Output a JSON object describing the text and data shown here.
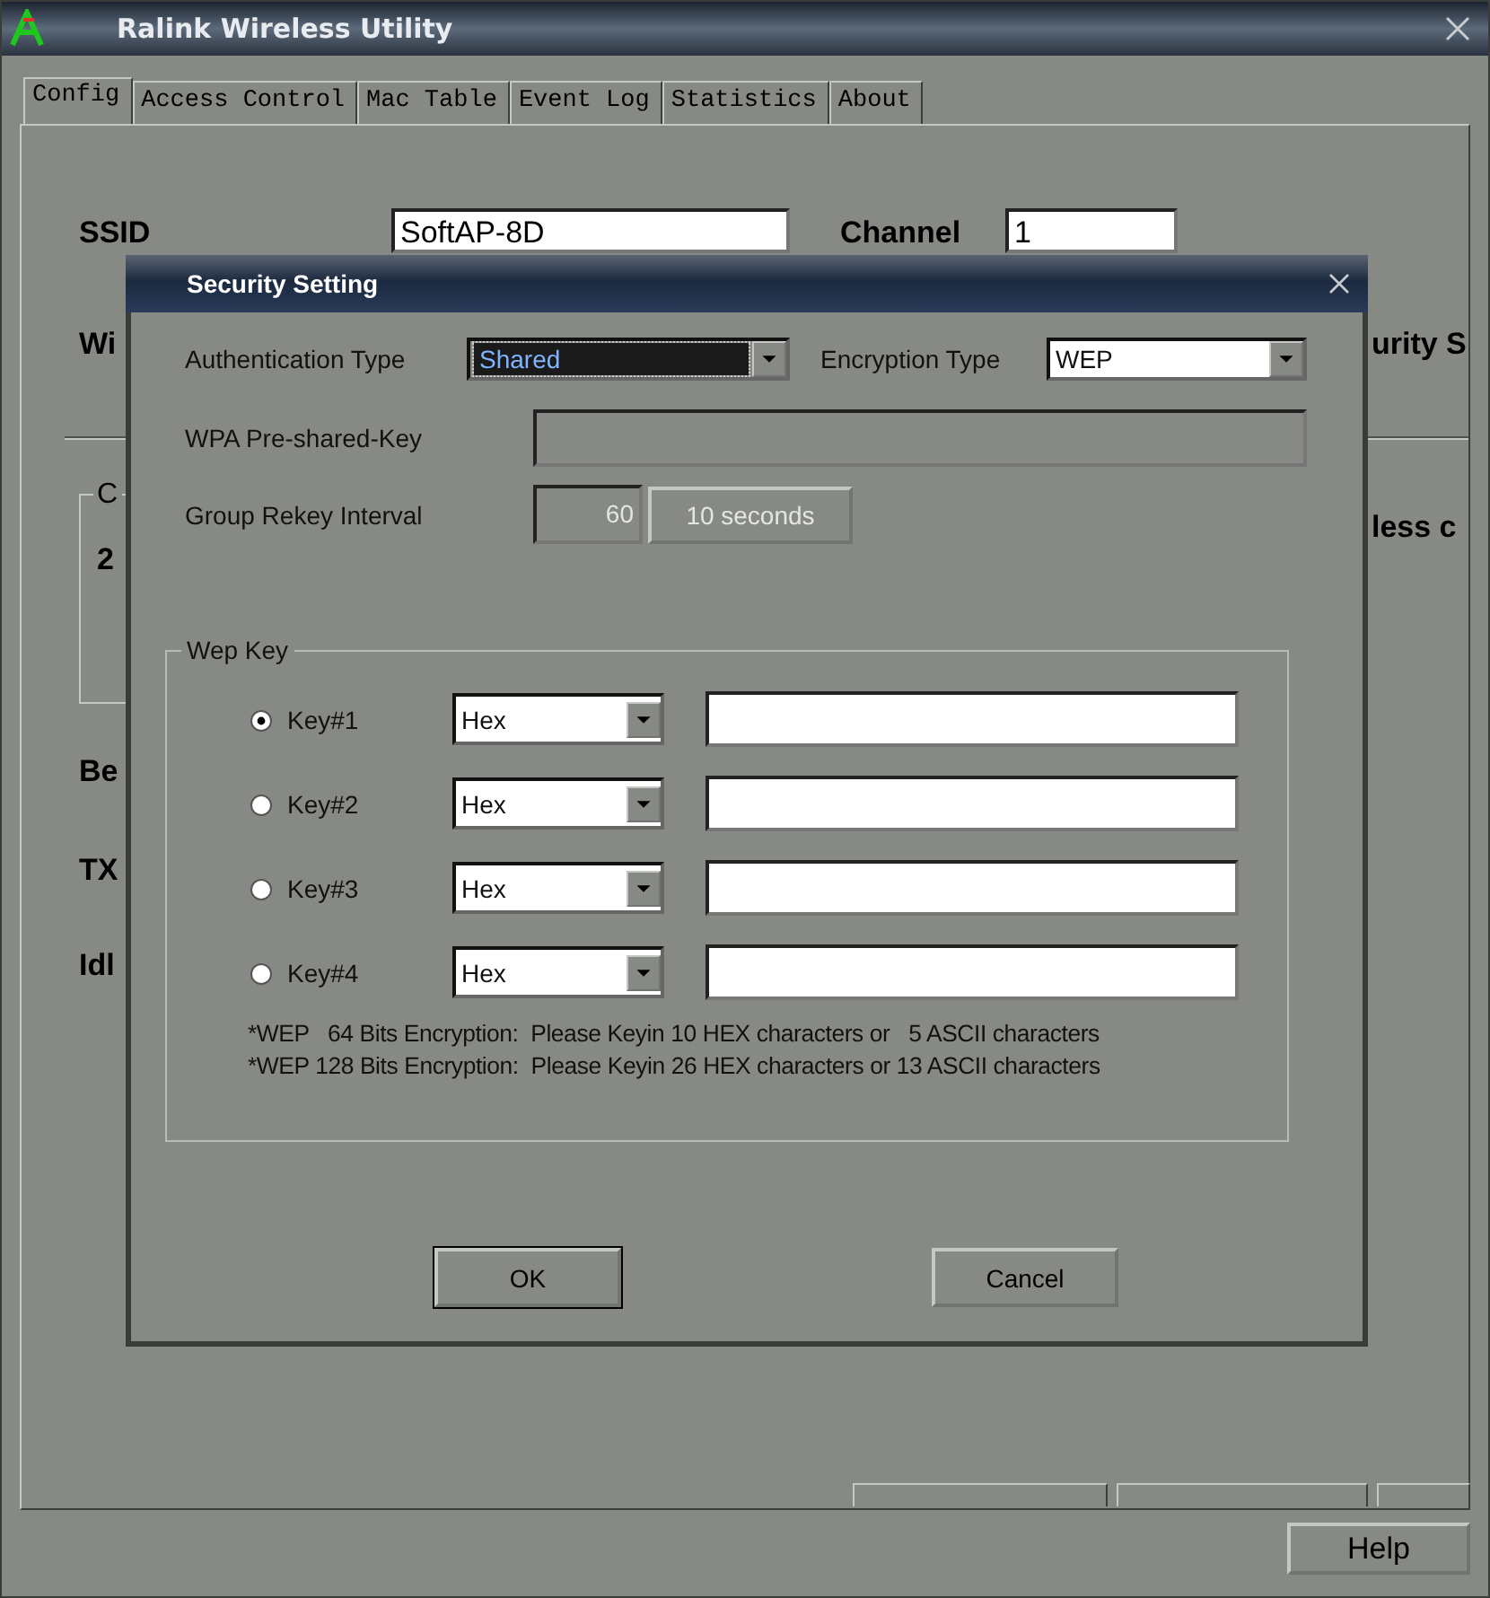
{
  "window": {
    "title": "Ralink Wireless Utility"
  },
  "tabs": [
    {
      "label": "Config",
      "selected": true
    },
    {
      "label": "Access Control",
      "selected": false
    },
    {
      "label": "Mac Table",
      "selected": false
    },
    {
      "label": "Event Log",
      "selected": false
    },
    {
      "label": "Statistics",
      "selected": false
    },
    {
      "label": "About",
      "selected": false
    }
  ],
  "config": {
    "ssid_label": "SSID",
    "ssid_value": "SoftAP-8D",
    "channel_label": "Channel",
    "channel_value": "1",
    "label_1": "Wi",
    "label_2": "urity S",
    "group_label": "C",
    "group_value": "2",
    "label_3": "less c",
    "label_4": "Be",
    "label_5": "TX",
    "label_6": "Idl"
  },
  "help_button": "Help",
  "dialog": {
    "title": "Security Setting",
    "auth_label": "Authentication Type",
    "auth_value": "Shared",
    "auth_focused": true,
    "enc_label": "Encryption Type",
    "enc_value": "WEP",
    "wpa_label": "WPA Pre-shared-Key",
    "wpa_disabled": true,
    "rekey_label": "Group Rekey Interval",
    "rekey_value": "60",
    "rekey_unit": "10 seconds",
    "rekey_disabled": true,
    "wep_group": "Wep Key",
    "keys": [
      {
        "label": "Key#1",
        "selected": true,
        "format": "Hex"
      },
      {
        "label": "Key#2",
        "selected": false,
        "format": "Hex"
      },
      {
        "label": "Key#3",
        "selected": false,
        "format": "Hex"
      },
      {
        "label": "Key#4",
        "selected": false,
        "format": "Hex"
      }
    ],
    "notes": [
      "*WEP   64 Bits Encryption:  Please Keyin 10 HEX characters or   5 ASCII characters",
      "*WEP 128 Bits Encryption:  Please Keyin 26 HEX characters or 13 ASCII characters"
    ],
    "ok_button": "OK",
    "cancel_button": "Cancel"
  }
}
